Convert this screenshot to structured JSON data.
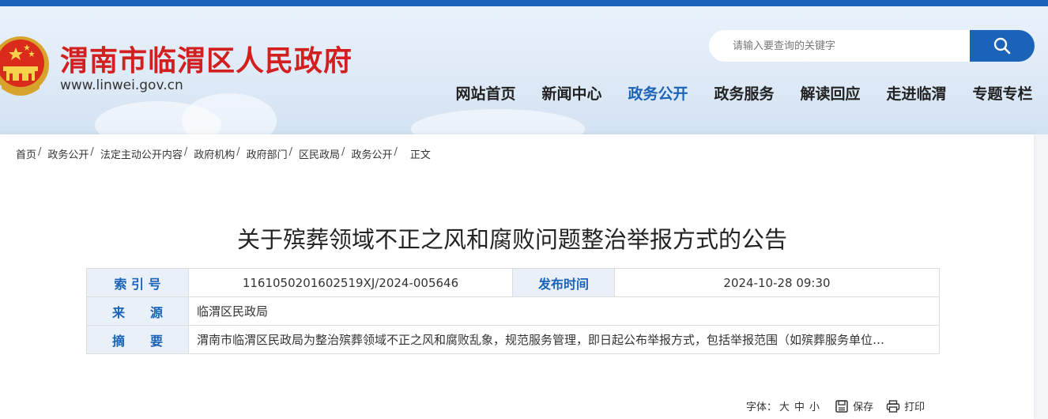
{
  "header": {
    "site_title": "渭南市临渭区人民政府",
    "site_url": "www.linwei.gov.cn",
    "search_placeholder": "请输入要查询的关键字",
    "brand_red": "#d21f1f",
    "brand_blue": "#1a63b8"
  },
  "nav": {
    "items": [
      "网站首页",
      "新闻中心",
      "政务公开",
      "政务服务",
      "解读回应",
      "走进临渭",
      "专题专栏"
    ],
    "active": "政务公开"
  },
  "breadcrumb": {
    "items": [
      "首页",
      "政务公开",
      "法定主动公开内容",
      "政府机构",
      "政府部门",
      "区民政局",
      "政务公开"
    ],
    "separator": "/",
    "current": "正文"
  },
  "article": {
    "title": "关于殡葬领域不正之风和腐败问题整治举报方式的公告"
  },
  "meta": {
    "index_label": "索 引 号",
    "index_value": "1161050201602519XJ/2024-005646",
    "date_label": "发布时间",
    "date_value": "2024-10-28 09:30",
    "source_label": "来　　源",
    "source_value": "临渭区民政局",
    "abstract_label": "摘　　要",
    "abstract_value": "渭南市临渭区民政局为整治殡葬领域不正之风和腐败乱象，规范服务管理，即日起公布举报方式，包括举报范围（如殡葬服务单位…"
  },
  "tools": {
    "font_label": "字体：",
    "size_large": "大",
    "size_medium": "中",
    "size_small": "小",
    "save_label": "保存",
    "print_label": "打印"
  }
}
